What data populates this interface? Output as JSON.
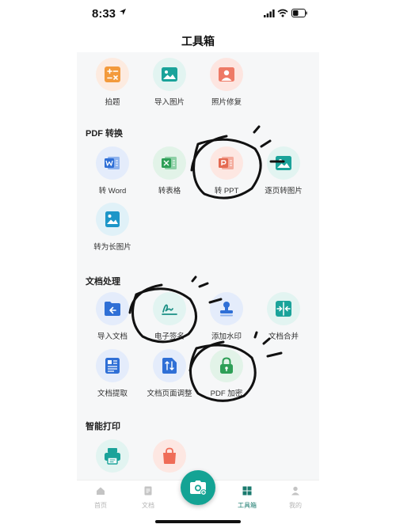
{
  "status_bar": {
    "time": "8:33"
  },
  "header": {
    "title": "工具箱"
  },
  "colors": {
    "accent": "#14a394",
    "word": "#2f6fd6",
    "excel": "#2e9f57",
    "ppt": "#e46a52",
    "image": "#1aa39a"
  },
  "top_tools": [
    {
      "label": "拍题",
      "icon": "calculator-icon"
    },
    {
      "label": "导入图片",
      "icon": "image-icon"
    },
    {
      "label": "照片修复",
      "icon": "portrait-icon"
    }
  ],
  "sections": [
    {
      "title": "PDF 转换",
      "tools": [
        {
          "label": "转 Word",
          "icon": "word-icon"
        },
        {
          "label": "转表格",
          "icon": "excel-icon"
        },
        {
          "label": "转 PPT",
          "icon": "ppt-icon"
        },
        {
          "label": "逐页转图片",
          "icon": "image-icon"
        },
        {
          "label": "转为长图片",
          "icon": "image-icon"
        }
      ]
    },
    {
      "title": "文档处理",
      "tools": [
        {
          "label": "导入文档",
          "icon": "import-document-icon"
        },
        {
          "label": "电子签名",
          "icon": "signature-icon"
        },
        {
          "label": "添加水印",
          "icon": "stamp-icon"
        },
        {
          "label": "文档合并",
          "icon": "merge-icon"
        },
        {
          "label": "文档提取",
          "icon": "extract-icon"
        },
        {
          "label": "文档页面调整",
          "icon": "page-adjust-icon"
        },
        {
          "label": "PDF 加密",
          "icon": "lock-icon"
        }
      ]
    },
    {
      "title": "智能打印",
      "tools": [
        {
          "label": "",
          "icon": "print-icon"
        },
        {
          "label": "",
          "icon": "bag-icon"
        }
      ]
    }
  ],
  "tabbar": {
    "items": [
      {
        "label": "首页",
        "icon": "home-icon"
      },
      {
        "label": "文档",
        "icon": "document-icon"
      },
      {
        "label": "工具箱",
        "icon": "grid-icon",
        "active": true
      },
      {
        "label": "我的",
        "icon": "user-icon"
      }
    ],
    "center_icon": "camera-icon"
  }
}
